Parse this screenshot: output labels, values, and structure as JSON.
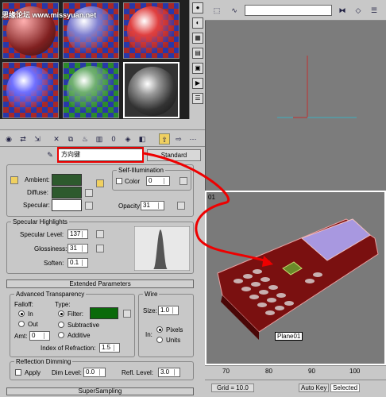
{
  "watermark": "思缘论坛 www.missyuan.net",
  "material_name": "方向键",
  "standard_label": "Standard",
  "basic": {
    "ambient": "Ambient:",
    "diffuse": "Diffuse:",
    "specular": "Specular:",
    "self_illum_title": "Self-Illumination",
    "color_label": "Color",
    "color_value": "0",
    "opacity_label": "Opacity:",
    "opacity_value": "31",
    "ambient_color": "#2e5a2e",
    "diffuse_color": "#2e5a2e",
    "specular_color": "#ffffff"
  },
  "spec": {
    "title": "Specular Highlights",
    "level_label": "Specular Level:",
    "level_value": "137",
    "gloss_label": "Glossiness:",
    "gloss_value": "31",
    "soften_label": "Soften:",
    "soften_value": "0.1"
  },
  "extended_title": "Extended Parameters",
  "adv": {
    "title": "Advanced Transparency",
    "falloff": "Falloff:",
    "type": "Type:",
    "in": "In",
    "out": "Out",
    "filter": "Filter:",
    "subtractive": "Subtractive",
    "additive": "Additive",
    "amt_label": "Amt:",
    "amt_value": "0",
    "ior_label": "Index of Refraction:",
    "ior_value": "1.5",
    "filter_color": "#0a6a0a"
  },
  "wire": {
    "title": "Wire",
    "size_label": "Size:",
    "size_value": "1.0",
    "in_label": "In:",
    "pixels": "Pixels",
    "units": "Units"
  },
  "refl": {
    "title": "Reflection Dimming",
    "apply": "Apply",
    "dim_label": "Dim Level:",
    "dim_value": "0.0",
    "refl_label": "Refl. Level:",
    "refl_value": "3.0"
  },
  "supersampling": "SuperSampling",
  "viewport": {
    "label": "Plane01",
    "vp_corner": "01"
  },
  "ruler_ticks": [
    "70",
    "80",
    "90",
    "100"
  ],
  "status": {
    "grid": "Grid = 10.0",
    "autokey": "Auto Key",
    "selected": "Selected"
  }
}
